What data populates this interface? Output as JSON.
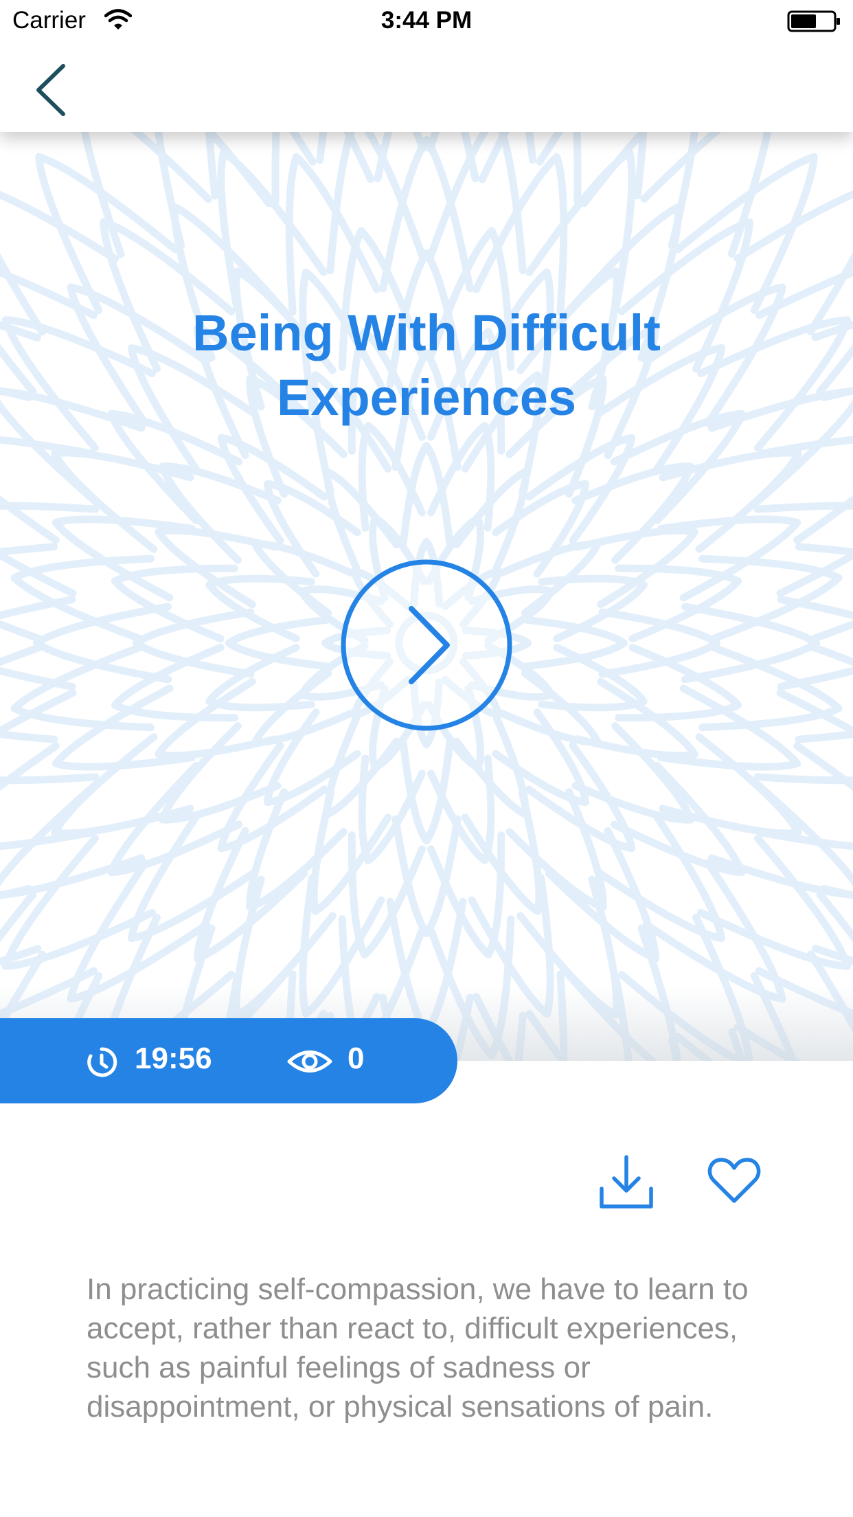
{
  "status_bar": {
    "carrier": "Carrier",
    "time": "3:44 PM",
    "battery_level": 0.6
  },
  "nav": {
    "back_icon": "chevron-left-icon"
  },
  "hero": {
    "title": "Being With Difficult Experiences",
    "play_icon": "play-chevron-icon",
    "background_pattern": "mandala"
  },
  "meta": {
    "duration": "19:56",
    "views": "0",
    "timer_icon": "timer-icon",
    "views_icon": "eye-icon"
  },
  "actions": {
    "download_icon": "download-icon",
    "favorite_icon": "heart-icon"
  },
  "description": "In practicing self-compassion, we have to learn to accept, rather than react to, difficult experiences, such as painful feelings of sadness or disappointment, or physical sensations of pain.",
  "colors": {
    "accent": "#2483e4",
    "pattern": "#e2effb",
    "back_icon": "#1e4d5c",
    "body_text": "#8e8e8e"
  }
}
